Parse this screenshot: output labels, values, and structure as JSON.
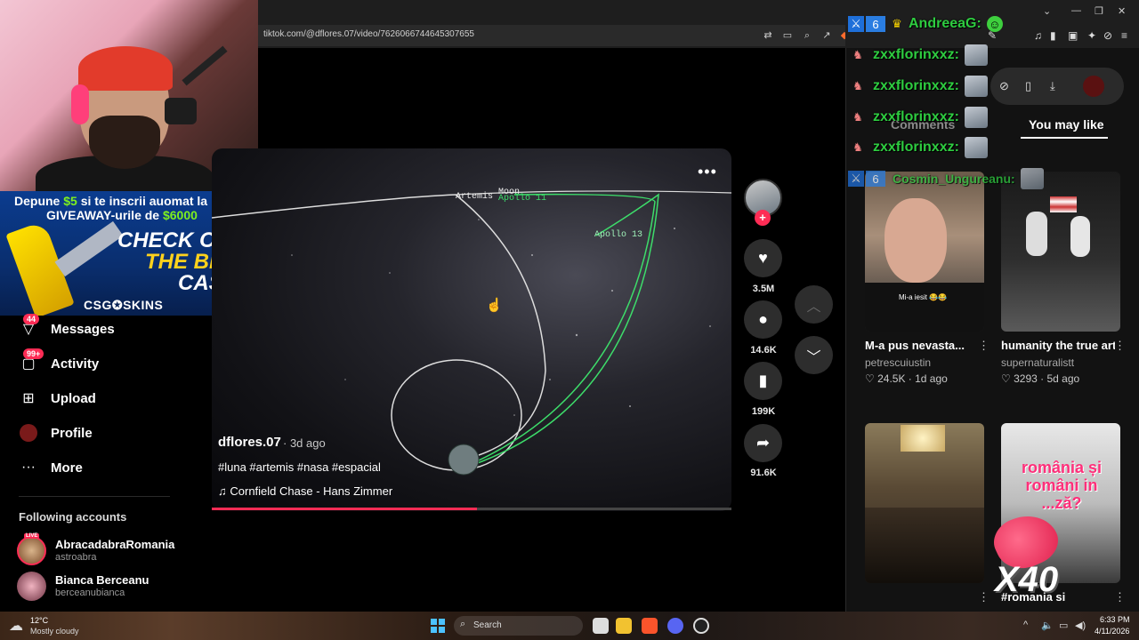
{
  "browser": {
    "url": "tiktok.com/@dflores.07/video/7626066744645307655"
  },
  "promo": {
    "line1_a": "Depune ",
    "line1_b": "$5",
    "line1_c": " si te inscrii auomat la",
    "line2_a": "GIVEAWAY-urile de ",
    "line2_b": "$6000",
    "check_out": "CHECK OUT",
    "the_best": "THE BEST",
    "cases": "CASES",
    "brand": "CSG✪SKINS"
  },
  "sidebar": {
    "items": [
      {
        "label": "Messages",
        "badge": "44"
      },
      {
        "label": "Activity",
        "badge": "99+"
      },
      {
        "label": "Upload",
        "badge": ""
      },
      {
        "label": "Profile",
        "badge": ""
      },
      {
        "label": "More",
        "badge": ""
      }
    ],
    "following_title": "Following accounts",
    "accounts": [
      {
        "name": "AbracadabraRomania",
        "handle": "astroabra",
        "live": "LIVE"
      },
      {
        "name": "Bianca Berceanu",
        "handle": "berceanubianca"
      }
    ]
  },
  "video": {
    "username": "dflores.07",
    "date": "· 3d ago",
    "tags": "#luna #artemis #nasa #espacial",
    "music": "Cornfield Chase - Hans Zimmer",
    "labels": {
      "artemis": "Artemis",
      "moon": "Moon",
      "apollo11": "Apollo 11",
      "apollo13": "Apollo 13"
    },
    "progress": 0.51
  },
  "actions": {
    "likes": "3.5M",
    "comments": "14.6K",
    "saves": "199K",
    "shares": "91.6K"
  },
  "panel": {
    "tabs": [
      "Comments",
      "You may like"
    ],
    "active_tab": "You may like",
    "cards": [
      {
        "title": "M-a pus nevasta...",
        "author": "petrescuiustin",
        "likes": "♡ 24.5K",
        "age": "· 1d ago",
        "overlay": "Mi-a iesit 😂😂"
      },
      {
        "title": "humanity the true art. #fyp #atheis...",
        "author": "supernaturalistt",
        "likes": "♡ 3293",
        "age": "· 5d ago",
        "overlay": ""
      },
      {
        "title": "",
        "author": "",
        "likes": "",
        "age": "",
        "overlay": ""
      },
      {
        "title": "#romania si",
        "author": "",
        "likes": "",
        "age": "",
        "overlay": "românia și români in ...ză?"
      }
    ]
  },
  "chat": {
    "top_name": "AndreeaG:",
    "lines": [
      "zxxflorinxxz:",
      "zxxflorinxxz:",
      "zxxflorinxxz:",
      "zxxflorinxxz:"
    ],
    "bottom_name": "Cosmin_Ungureanu:",
    "combo": "X40"
  },
  "taskbar": {
    "temp": "12°C",
    "condition": "Mostly cloudy",
    "search": "Search",
    "time": "6:33 PM",
    "date": "4/11/2026"
  },
  "colors": {
    "accent": "#fe2c55",
    "chat_green": "#2ecc40",
    "orbit_green": "#3ddc6a"
  }
}
